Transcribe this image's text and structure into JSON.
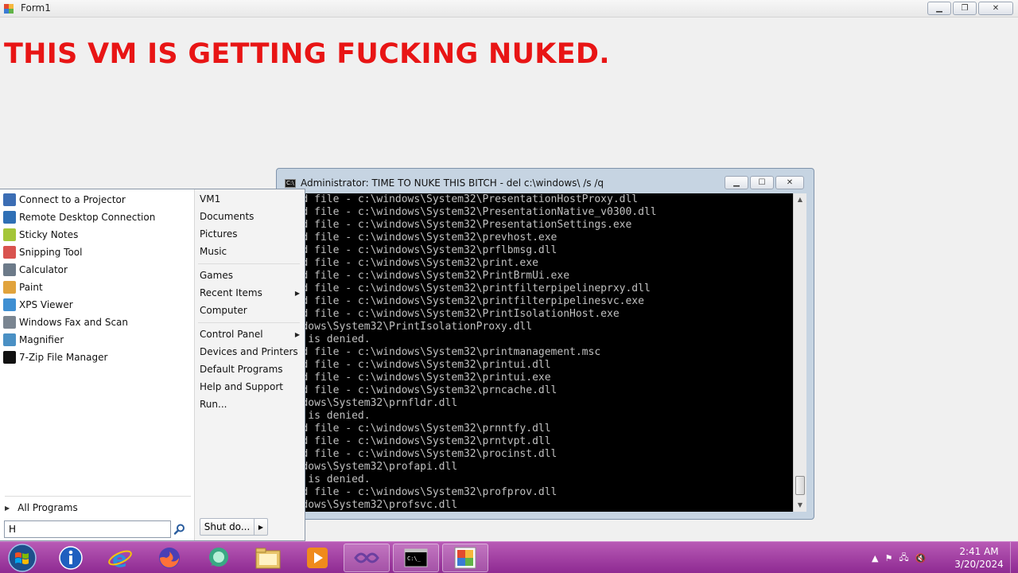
{
  "form1": {
    "title": "Form1",
    "headline": "THIS VM IS GETTING FUCKING NUKED.",
    "headline_color": "#e81515"
  },
  "console": {
    "title": "Administrator:  TIME TO NUKE THIS BITCH - del  c:\\windows\\ /s /q",
    "lines": [
      "eted file - c:\\windows\\System32\\PresentationHostProxy.dll",
      "eted file - c:\\windows\\System32\\PresentationNative_v0300.dll",
      "eted file - c:\\windows\\System32\\PresentationSettings.exe",
      "eted file - c:\\windows\\System32\\prevhost.exe",
      "eted file - c:\\windows\\System32\\prflbmsg.dll",
      "eted file - c:\\windows\\System32\\print.exe",
      "eted file - c:\\windows\\System32\\PrintBrmUi.exe",
      "eted file - c:\\windows\\System32\\printfilterpipelineprxy.dll",
      "eted file - c:\\windows\\System32\\printfilterpipelinesvc.exe",
      "eted file - c:\\windows\\System32\\PrintIsolationHost.exe",
      "windows\\System32\\PrintIsolationProxy.dll",
      "ess is denied.",
      "eted file - c:\\windows\\System32\\printmanagement.msc",
      "eted file - c:\\windows\\System32\\printui.dll",
      "eted file - c:\\windows\\System32\\printui.exe",
      "eted file - c:\\windows\\System32\\prncache.dll",
      "windows\\System32\\prnfldr.dll",
      "ess is denied.",
      "eted file - c:\\windows\\System32\\prnntfy.dll",
      "eted file - c:\\windows\\System32\\prntvpt.dll",
      "eted file - c:\\windows\\System32\\procinst.dll",
      "windows\\System32\\profapi.dll",
      "ess is denied.",
      "eted file - c:\\windows\\System32\\profprov.dll",
      "windows\\System32\\profsvc.dll"
    ]
  },
  "start_menu": {
    "programs": [
      {
        "label": "Connect to a Projector",
        "icon": "projector-icon",
        "color": "#3b6db4"
      },
      {
        "label": "Remote Desktop Connection",
        "icon": "remote-desktop-icon",
        "color": "#2f6fb5"
      },
      {
        "label": "Sticky Notes",
        "icon": "sticky-notes-icon",
        "color": "#a4c639"
      },
      {
        "label": "Snipping Tool",
        "icon": "scissors-icon",
        "color": "#d9534f"
      },
      {
        "label": "Calculator",
        "icon": "calculator-icon",
        "color": "#6c7a89"
      },
      {
        "label": "Paint",
        "icon": "paint-icon",
        "color": "#e1a33c"
      },
      {
        "label": "XPS Viewer",
        "icon": "xps-viewer-icon",
        "color": "#3f8fd2"
      },
      {
        "label": "Windows Fax and Scan",
        "icon": "fax-icon",
        "color": "#7a8591"
      },
      {
        "label": "Magnifier",
        "icon": "magnifier-icon",
        "color": "#4a90c4"
      },
      {
        "label": "7-Zip File Manager",
        "icon": "7zip-icon",
        "color": "#111111"
      }
    ],
    "all_programs": "All Programs",
    "search_value": "H",
    "places": [
      {
        "label": "VM1",
        "submenu": false
      },
      {
        "label": "Documents",
        "submenu": false
      },
      {
        "label": "Pictures",
        "submenu": false
      },
      {
        "label": "Music",
        "submenu": false
      },
      {
        "label": "Games",
        "submenu": false
      },
      {
        "label": "Recent Items",
        "submenu": true
      },
      {
        "label": "Computer",
        "submenu": false
      },
      {
        "label": "Control Panel",
        "submenu": true
      },
      {
        "label": "Devices and Printers",
        "submenu": false
      },
      {
        "label": "Default Programs",
        "submenu": false
      },
      {
        "label": "Help and Support",
        "submenu": false
      },
      {
        "label": "Run...",
        "submenu": false
      }
    ],
    "shutdown": "Shut do..."
  },
  "taskbar": {
    "time": "2:41 AM",
    "date": "3/20/2024",
    "buttons": [
      "start-orb",
      "info-icon",
      "internet-explorer-icon",
      "firefox-icon",
      "chat-icon",
      "file-explorer-icon",
      "media-player-icon",
      "visual-studio-icon",
      "command-prompt-icon",
      "form-app-icon"
    ]
  }
}
